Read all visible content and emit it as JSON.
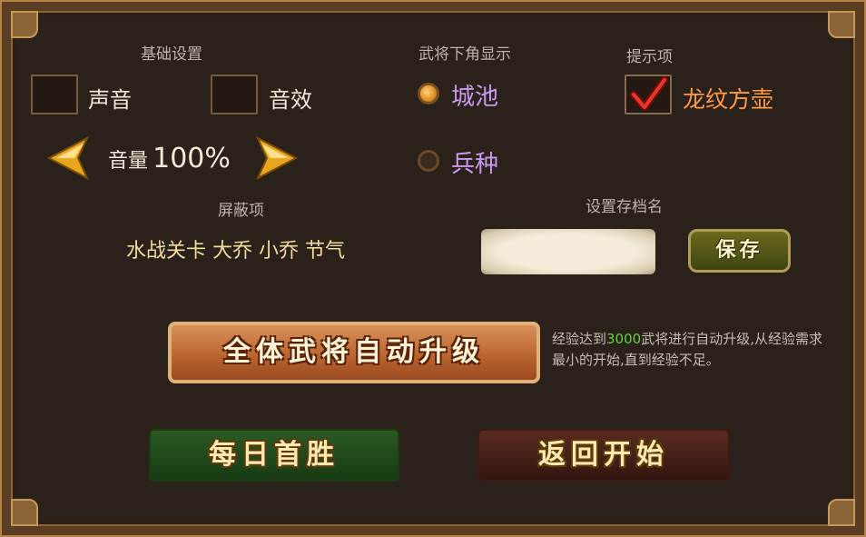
{
  "basic": {
    "header": "基础设置",
    "sound_label": "声音",
    "sfx_label": "音效",
    "sound_checked": false,
    "sfx_checked": false,
    "volume_prefix": "音量",
    "volume_value": "100%"
  },
  "corner_display": {
    "header": "武将下角显示",
    "options": [
      {
        "label": "城池",
        "selected": true
      },
      {
        "label": "兵种",
        "selected": false
      }
    ]
  },
  "hints": {
    "header": "提示项",
    "item_label": "龙纹方壶",
    "item_checked": true
  },
  "shield": {
    "header": "屏蔽项",
    "items": "水战关卡 大乔 小乔 节气"
  },
  "save_name": {
    "header": "设置存档名",
    "input_value": "",
    "save_button": "保存"
  },
  "auto_upgrade": {
    "button": "全体武将自动升级",
    "desc_prefix": "经验达到",
    "desc_highlight": "3000",
    "desc_suffix": "武将进行自动升级,从经验需求最小的开始,直到经验不足。"
  },
  "footer": {
    "daily_button": "每日首胜",
    "back_button": "返回开始"
  },
  "colors": {
    "highlight_green": "#5dd43d",
    "radio_label": "#c99bf0",
    "hint_label": "#ff9a44"
  }
}
